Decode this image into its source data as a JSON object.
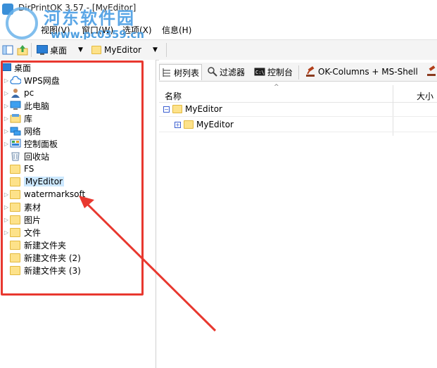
{
  "window": {
    "title": "DirPrintOK 3.57 - [MyEditor]"
  },
  "watermark": {
    "brand": "河东软件园",
    "url": "www.pc0359.cn"
  },
  "menubar": {
    "items": [
      "视图(V)",
      "窗口(W)",
      "选项(X)",
      "信息(H)"
    ]
  },
  "toolbar": {
    "location": "桌面",
    "current_folder": "MyEditor"
  },
  "tree": {
    "root": "桌面",
    "items": [
      {
        "label": "WPS网盘",
        "icon": "cloud-icon"
      },
      {
        "label": "pc",
        "icon": "user-icon"
      },
      {
        "label": "此电脑",
        "icon": "computer-icon"
      },
      {
        "label": "库",
        "icon": "library-icon"
      },
      {
        "label": "网络",
        "icon": "network-icon"
      },
      {
        "label": "控制面板",
        "icon": "control-panel-icon"
      },
      {
        "label": "回收站",
        "icon": "recycle-bin-icon"
      },
      {
        "label": "FS",
        "icon": "folder-icon"
      },
      {
        "label": "MyEditor",
        "icon": "folder-icon",
        "selected": true
      },
      {
        "label": "watermarksoft",
        "icon": "folder-icon"
      },
      {
        "label": "素材",
        "icon": "folder-icon"
      },
      {
        "label": "图片",
        "icon": "folder-icon"
      },
      {
        "label": "文件",
        "icon": "folder-icon"
      },
      {
        "label": "新建文件夹",
        "icon": "folder-icon"
      },
      {
        "label": "新建文件夹 (2)",
        "icon": "folder-icon"
      },
      {
        "label": "新建文件夹 (3)",
        "icon": "folder-icon"
      }
    ]
  },
  "tabs": [
    "树列表",
    "过滤器",
    "控制台",
    "OK-Columns + MS-Shell"
  ],
  "list": {
    "columns": [
      "名称",
      "大小"
    ],
    "rows": [
      "MyEditor",
      "MyEditor"
    ]
  },
  "colors": {
    "annotation_red": "#e8382f",
    "selection": "#cce8ff",
    "folder": "#fde28a"
  }
}
